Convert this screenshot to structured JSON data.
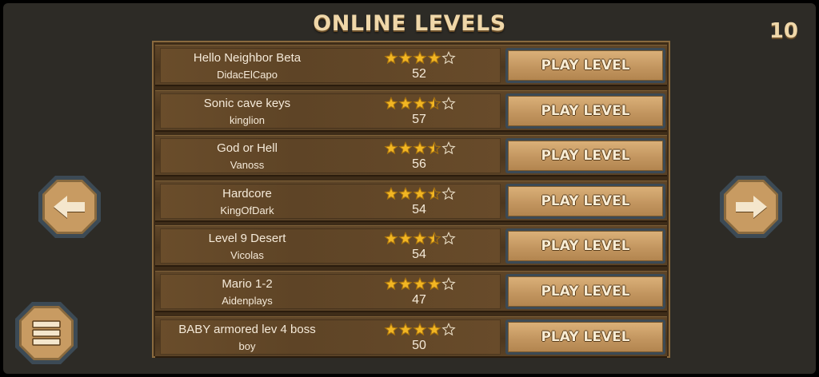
{
  "header": {
    "title": "ONLINE LEVELS",
    "counter": "10"
  },
  "play_label": "PLAY LEVEL",
  "levels": [
    {
      "name": "Hello Neighbor Beta",
      "author": "DidacElCapo",
      "plays": "52",
      "rating": 4
    },
    {
      "name": "Sonic cave keys",
      "author": "kinglion",
      "plays": "57",
      "rating": 3.5
    },
    {
      "name": "God or Hell",
      "author": "Vanoss",
      "plays": "56",
      "rating": 3.5
    },
    {
      "name": "Hardcore",
      "author": "KingOfDark",
      "plays": "54",
      "rating": 3.5
    },
    {
      "name": "Level 9 Desert",
      "author": "Vicolas",
      "plays": "54",
      "rating": 3.5
    },
    {
      "name": "Mario 1-2",
      "author": "Aidenplays",
      "plays": "47",
      "rating": 4
    },
    {
      "name": "BABY armored lev 4 boss",
      "author": "boy",
      "plays": "50",
      "rating": 4
    }
  ],
  "rating_max": 5,
  "colors": {
    "star": "#f2b623",
    "panel": "#5e4426",
    "button": "#c39660",
    "frame": "#3c4a55",
    "text": "#f5ead9"
  },
  "icons": {
    "prev": "arrow-left-icon",
    "next": "arrow-right-icon",
    "menu": "hamburger-menu-icon",
    "star": "star-icon"
  }
}
